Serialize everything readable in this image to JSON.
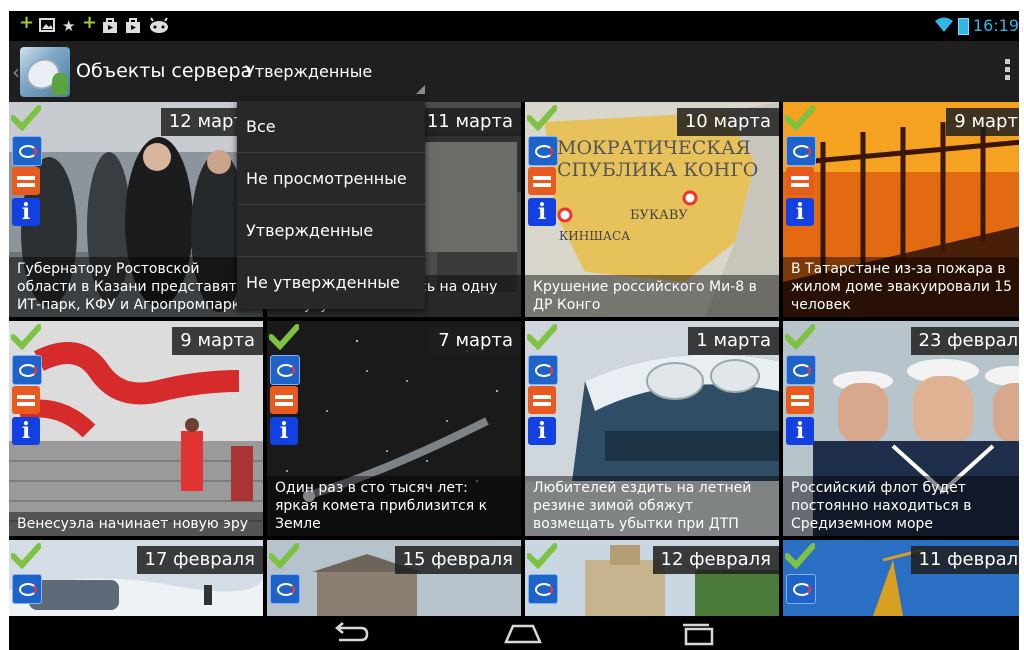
{
  "status_bar": {
    "time": "16:19",
    "left_icons": [
      "plus-icon",
      "image-icon",
      "star-icon",
      "plus-icon",
      "shopping-bag-icon",
      "shopping-bag-icon",
      "android-icon"
    ],
    "right_icons": [
      "wifi-icon",
      "battery-icon"
    ]
  },
  "action_bar": {
    "title": "Объекты сервера",
    "spinner_value": "Утвержденные"
  },
  "dropdown": {
    "options": [
      "Все",
      "Не просмотренные",
      "Утвержденные",
      "Не утвержденные"
    ]
  },
  "tiles": [
    {
      "date": "12 марта",
      "caption": "Губернатору Ростовской области в Казани представят ИТ-парк, КФУ и Агропромпарк"
    },
    {
      "date": "11 марта",
      "caption": "Япония остановилась на одну минуту"
    },
    {
      "date": "10 марта",
      "caption": "Крушение российского Ми-8 в ДР Конго"
    },
    {
      "date": "9 марта",
      "caption": "В Татарстане из-за пожара в жилом доме эвакуировали 15 человек"
    },
    {
      "date": "9 марта",
      "caption": "Венесуэла начинает новую эру"
    },
    {
      "date": "7 марта",
      "caption": "Один раз в сто тысяч лет: яркая комета приблизится к Земле"
    },
    {
      "date": "1 марта",
      "caption": "Любителей ездить на летней резине зимой обяжут возмещать убытки при ДТП"
    },
    {
      "date": "23 февраля",
      "caption": "Российский флот будет постоянно находиться в Средиземном море"
    },
    {
      "date": "17 февраля",
      "caption": ""
    },
    {
      "date": "15 февраля",
      "caption": ""
    },
    {
      "date": "12 февраля",
      "caption": ""
    },
    {
      "date": "11 февраля",
      "caption": ""
    }
  ],
  "map_tile_text": {
    "line1": "МОКРАТИЧЕСКАЯ",
    "line2": "СПУБЛИКА КОНГО",
    "city1": "БУКАВУ",
    "city2": "КИНШАСА"
  },
  "badges": {
    "flag": "flag-icon",
    "hands": "handshake-icon",
    "info": "i"
  },
  "nav_bar": {
    "buttons": [
      "back-icon",
      "home-icon",
      "recent-apps-icon"
    ]
  },
  "colors": {
    "accent": "#33b5e5",
    "check": "#7dc242",
    "info_badge": "#1340e0",
    "hands_badge": "#e85a1e",
    "flag_badge": "#1e63c8"
  }
}
